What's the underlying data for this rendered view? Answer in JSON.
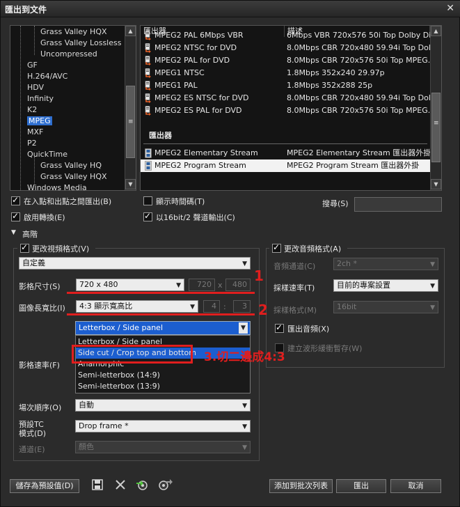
{
  "window": {
    "title": "匯出到文件",
    "close_glyph": "✕"
  },
  "tree": {
    "items": [
      {
        "label": "Grass Valley HQX",
        "indent": 2
      },
      {
        "label": "Grass Valley Lossless",
        "indent": 2
      },
      {
        "label": "Uncompressed",
        "indent": 2
      },
      {
        "label": "GF",
        "indent": 1
      },
      {
        "label": "H.264/AVC",
        "indent": 1
      },
      {
        "label": "HDV",
        "indent": 1
      },
      {
        "label": "Infinity",
        "indent": 1
      },
      {
        "label": "K2",
        "indent": 1
      },
      {
        "label": "MPEG",
        "indent": 1,
        "selected": true
      },
      {
        "label": "MXF",
        "indent": 1
      },
      {
        "label": "P2",
        "indent": 1
      },
      {
        "label": "QuickTime",
        "indent": 1
      },
      {
        "label": "Grass Valley HQ",
        "indent": 2
      },
      {
        "label": "Grass Valley HQX",
        "indent": 2
      },
      {
        "label": "Windows Media",
        "indent": 1
      }
    ]
  },
  "exporters": {
    "col_name": "匯出器",
    "col_desc": "描述",
    "rows": [
      {
        "name": "MPEG2 PAL 6Mbps VBR",
        "desc": "6Mbps VBR 720x576 50i Top Dolby Di..."
      },
      {
        "name": "MPEG2 NTSC for DVD",
        "desc": "8.0Mbps CBR 720x480 59.94i Top Dol..."
      },
      {
        "name": "MPEG2 PAL for DVD",
        "desc": "8.0Mbps CBR 720x576 50i Top MPEG..."
      },
      {
        "name": "MPEG1 NTSC",
        "desc": "1.8Mbps 352x240 29.97p"
      },
      {
        "name": "MPEG1 PAL",
        "desc": "1.8Mbps 352x288 25p"
      },
      {
        "name": "MPEG2 ES NTSC for DVD",
        "desc": "8.0Mbps CBR 720x480 59.94i Top Dol..."
      },
      {
        "name": "MPEG2 ES PAL for DVD",
        "desc": "8.0Mbps CBR 720x576 50i Top MPEG..."
      }
    ],
    "section_label": "匯出器",
    "plugin_rows": [
      {
        "name": "MPEG2 Elementary Stream",
        "desc": "MPEG2 Elementary Stream 匯出器外掛"
      },
      {
        "name": "MPEG2 Program Stream",
        "desc": "MPEG2 Program Stream 匯出器外掛",
        "selected": true
      }
    ]
  },
  "options": {
    "in_out_label": "在入點和出點之間匯出(B)",
    "convert_label": "啟用轉換(E)",
    "show_tc_label": "顯示時間碼(T)",
    "bit16_label": "以16bit/2 聲道輸出(C)",
    "search_label": "搜尋(S)",
    "search_value": ""
  },
  "advanced": {
    "label": "高階",
    "toggle": "▼"
  },
  "video": {
    "group_label": "更改視頻格式(V)",
    "preset": "自定義",
    "size_label": "影格尺寸(S)",
    "size_value": "720 x 480",
    "width": "720",
    "x_sep": "x",
    "height": "480",
    "aspect_label": "圖像長寬比(I)",
    "aspect_value": "4:3 顯示寬高比",
    "aspect_w": "4",
    "colon": ":",
    "aspect_h": "3",
    "conversion_value": "Letterbox / Side panel",
    "conversion_options": [
      "Letterbox / Side panel",
      "Side cut / Crop top and bottom",
      "Anamorphic",
      "Semi-letterbox (14:9)",
      "Semi-letterbox (13:9)"
    ],
    "framerate_label": "影格速率(F)",
    "field_order_label": "場次順序(O)",
    "field_order_value": "自動",
    "tc_label_1": "預設TC",
    "tc_label_2": "模式(D)",
    "tc_value": "Drop frame *",
    "channel_label": "通道(E)",
    "channel_value": "顏色"
  },
  "audio": {
    "group_label": "更改音頻格式(A)",
    "channels_label": "音頻通道(C)",
    "channels_value": "2ch *",
    "samplerate_label": "採樣速率(T)",
    "samplerate_value": "目前的專案設置",
    "sampleformat_label": "採樣格式(M)",
    "sampleformat_value": "16bit",
    "export_audio_label": "匯出音頻(X)",
    "waveform_label": "建立波形緩衝暫存(W)"
  },
  "annotations": {
    "one": "1",
    "two": "2",
    "three": "3.切二邊成4:3"
  },
  "buttons": {
    "save_preset": "儲存為預設值(D)",
    "add_batch": "添加到批次列表",
    "export": "匯出",
    "cancel": "取消"
  },
  "colors": {
    "annotation_red": "#e01e1e",
    "selection_blue": "#2f6fd0"
  }
}
